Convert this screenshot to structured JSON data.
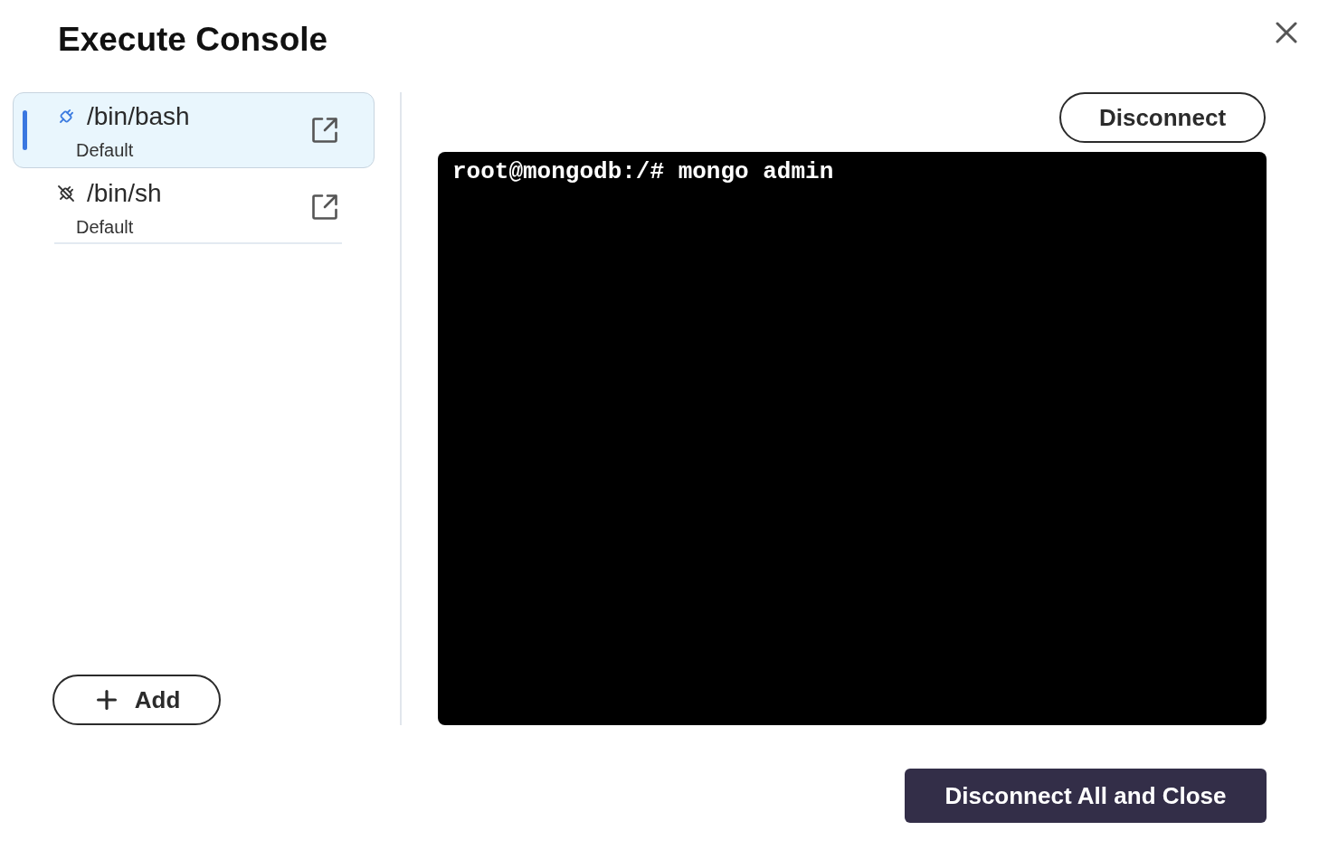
{
  "dialog": {
    "title": "Execute Console"
  },
  "sessions": [
    {
      "name": "/bin/bash",
      "label": "Default",
      "selected": true,
      "connected": true
    },
    {
      "name": "/bin/sh",
      "label": "Default",
      "selected": false,
      "connected": false
    }
  ],
  "add_button": {
    "label": "Add"
  },
  "disconnect_button": {
    "label": "Disconnect"
  },
  "terminal": {
    "lines": [
      "root@mongodb:/# mongo admin"
    ]
  },
  "footer": {
    "primary_button": {
      "label": "Disconnect All and Close"
    }
  }
}
